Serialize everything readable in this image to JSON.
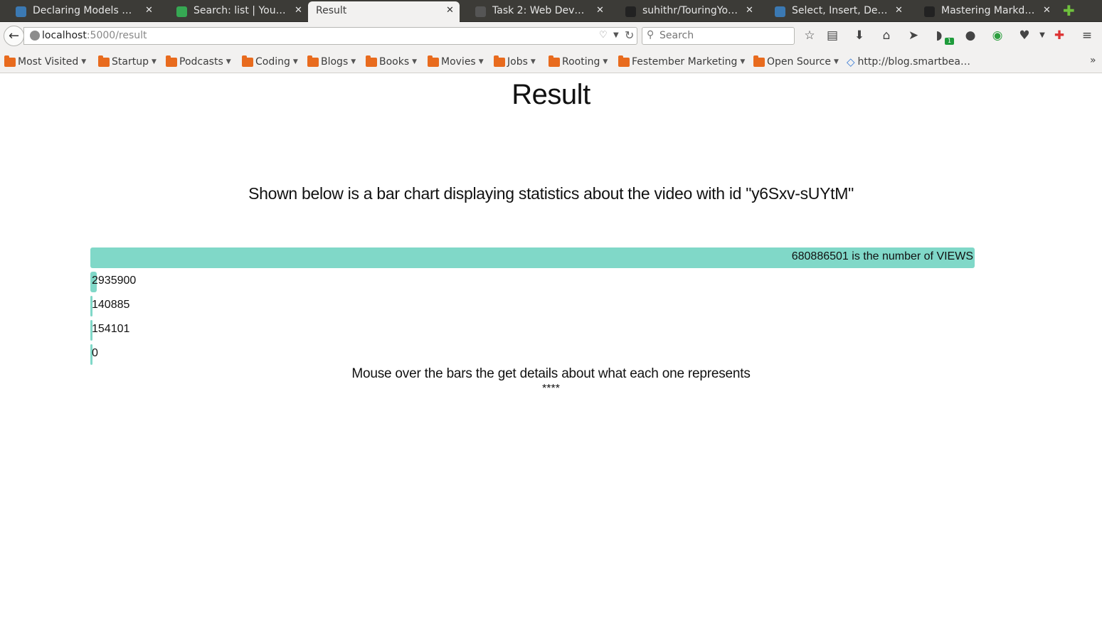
{
  "browser": {
    "tabs": [
      {
        "label": "Declaring Models —…",
        "icon_color": "#3b79b3"
      },
      {
        "label": "Search: list  |  YouT…",
        "icon_color": "#36a853"
      },
      {
        "label": "Result",
        "icon_color": "#f2f1f0",
        "active": true
      },
      {
        "label": "Task 2: Web Develo…",
        "icon_color": "#555555"
      },
      {
        "label": "suhithr/TouringYout…",
        "icon_color": "#222222"
      },
      {
        "label": "Select, Insert, Delet…",
        "icon_color": "#3b79b3"
      },
      {
        "label": "Mastering Markdow…",
        "icon_color": "#222222"
      }
    ],
    "close_glyph": "✕",
    "new_tab_glyph": "✚",
    "url_host": "localhost",
    "url_path": ":5000/result",
    "search_placeholder": "Search",
    "toolbar_icons": [
      "star-icon",
      "reading-list-icon",
      "download-icon",
      "home-icon",
      "send-icon",
      "extension-icon",
      "chat-icon",
      "pushbullet-icon",
      "pocket-icon",
      "addon-icon",
      "menu-icon"
    ],
    "extension_badge": "1",
    "bookmarks": [
      {
        "label": "Most Visited",
        "type": "folder"
      },
      {
        "label": "Startup",
        "type": "folder"
      },
      {
        "label": "Podcasts",
        "type": "folder"
      },
      {
        "label": "Coding",
        "type": "folder"
      },
      {
        "label": "Blogs",
        "type": "folder"
      },
      {
        "label": "Books",
        "type": "folder"
      },
      {
        "label": "Movies",
        "type": "folder"
      },
      {
        "label": "Jobs",
        "type": "folder"
      },
      {
        "label": "Rooting",
        "type": "folder"
      },
      {
        "label": "Festember Marketing",
        "type": "folder"
      },
      {
        "label": "Open Source",
        "type": "folder"
      },
      {
        "label": "http://blog.smartbea…",
        "type": "link"
      }
    ]
  },
  "page": {
    "title": "Result",
    "subtitle": "Shown below is a bar chart displaying statistics about the video with id \"y6Sxv-sUYtM\"",
    "note": "Mouse over the bars the get details about what each one represents",
    "stars": "****"
  },
  "chart_data": {
    "type": "bar",
    "orientation": "horizontal",
    "bar_color": "#80d8c8",
    "values": [
      680886501,
      2935900,
      140885,
      154101,
      0
    ],
    "labels": [
      "680886501 is the number of VIEWS",
      "2935900",
      "140885",
      "154101",
      "0"
    ]
  }
}
